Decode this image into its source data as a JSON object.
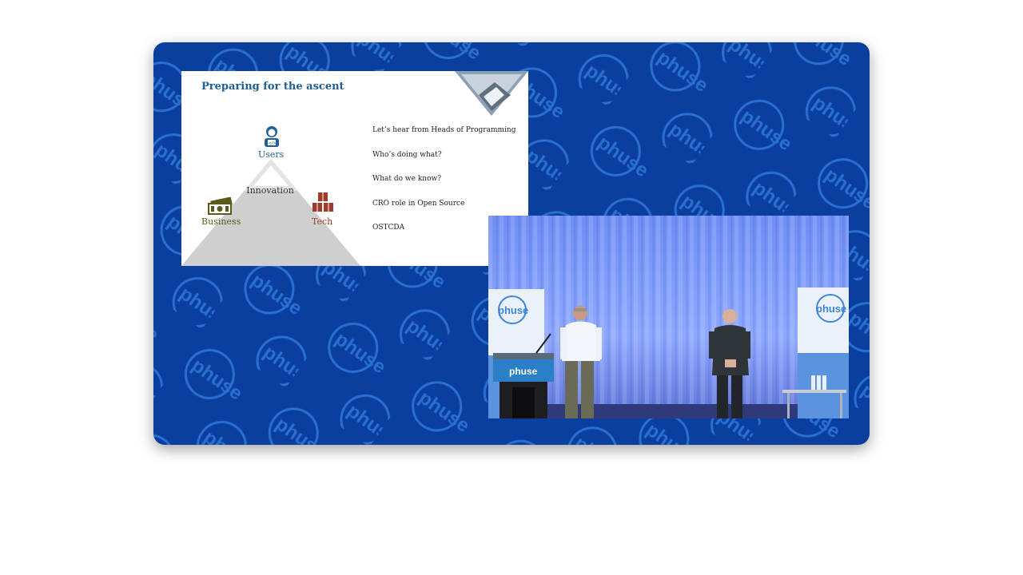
{
  "slide": {
    "title": "Preparing for the ascent",
    "pyramid": {
      "top_label": "Users",
      "left_label": "Business",
      "right_label": "Tech",
      "center_label": "Innovation"
    },
    "agenda": [
      "Let’s hear from Heads of Programming",
      "Who’s doing what?",
      "What do we know?",
      "CRO role in Open Source",
      "OSTCDA"
    ]
  },
  "brand": {
    "logo_text": "phuse",
    "background_color": "#0a3fa0",
    "pattern_color": "#2a6fd0"
  },
  "icons": {
    "users": "user-developer-icon",
    "business": "money-icon",
    "tech": "cubes-icon"
  }
}
